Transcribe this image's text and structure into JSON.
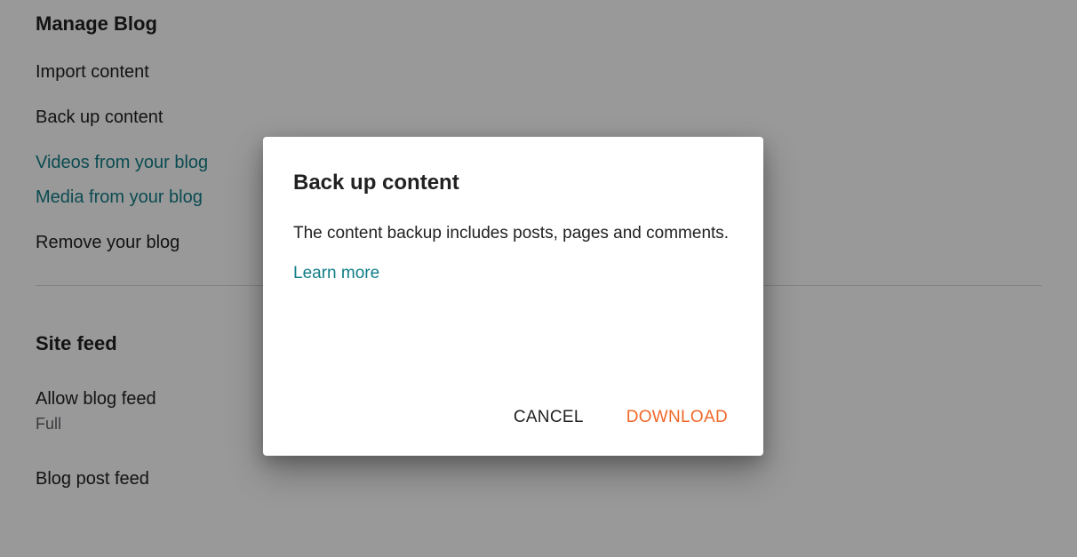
{
  "manage": {
    "heading": "Manage Blog",
    "items": [
      {
        "label": "Import content",
        "teal": false
      },
      {
        "label": "Back up content",
        "teal": false
      },
      {
        "label": "Videos from your blog",
        "teal": true
      },
      {
        "label": "Media from your blog",
        "teal": true
      },
      {
        "label": "Remove your blog",
        "teal": false
      }
    ]
  },
  "site_feed": {
    "heading": "Site feed",
    "allow_label": "Allow blog feed",
    "allow_value": "Full",
    "blog_post_label": "Blog post feed"
  },
  "dialog": {
    "title": "Back up content",
    "body": "The content backup includes posts, pages and comments.",
    "learn_more": "Learn more",
    "cancel": "CANCEL",
    "download": "DOWNLOAD"
  }
}
